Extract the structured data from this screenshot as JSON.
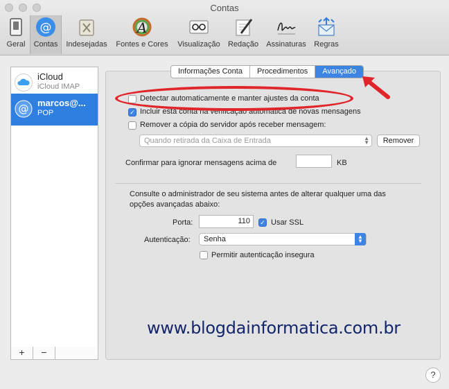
{
  "window": {
    "title": "Contas"
  },
  "toolbar": {
    "items": [
      {
        "label": "Geral",
        "icon": "switch-icon"
      },
      {
        "label": "Contas",
        "icon": "at-sign-icon",
        "selected": true
      },
      {
        "label": "Indesejadas",
        "icon": "junk-trash-icon"
      },
      {
        "label": "Fontes e Cores",
        "icon": "fonts-colors-icon"
      },
      {
        "label": "Visualização",
        "icon": "glasses-icon"
      },
      {
        "label": "Redação",
        "icon": "pencil-paper-icon"
      },
      {
        "label": "Assinaturas",
        "icon": "signature-icon"
      },
      {
        "label": "Regras",
        "icon": "rules-envelope-icon"
      }
    ]
  },
  "sidebar": {
    "accounts": [
      {
        "name": "iCloud",
        "type": "iCloud IMAP",
        "icon": "icloud-icon"
      },
      {
        "name": "marcos@...",
        "type": "POP",
        "icon": "at-sign-icon",
        "selected": true
      }
    ],
    "add_label": "+",
    "remove_label": "−"
  },
  "tabs": [
    {
      "label": "Informações Conta"
    },
    {
      "label": "Procedimentos"
    },
    {
      "label": "Avançado",
      "selected": true
    }
  ],
  "advanced": {
    "auto_detect": {
      "label": "Detectar automaticamente e manter ajustes da conta",
      "checked": false
    },
    "include_check": {
      "label": "Incluir esta conta na verificação automática de novas mensagens",
      "checked": true
    },
    "remove_copy": {
      "label": "Remover a cópia do servidor após receber mensagem:",
      "checked": false
    },
    "remove_when": {
      "value": "Quando retirada da Caixa de Entrada"
    },
    "remove_button": "Remover",
    "ignore_label": "Confirmar para ignorar mensagens acima de",
    "ignore_value": "",
    "ignore_unit": "KB",
    "admin_note_1": "Consulte o administrador de seu sistema antes de alterar qualquer uma das",
    "admin_note_2": "opções avançadas abaixo:",
    "port_label": "Porta:",
    "port_value": "110",
    "ssl": {
      "label": "Usar SSL",
      "checked": true
    },
    "auth_label": "Autenticação:",
    "auth_value": "Senha",
    "insecure_auth": {
      "label": "Permitir autenticação insegura",
      "checked": false
    }
  },
  "watermark": "www.blogdainformatica.com.br",
  "help_label": "?",
  "colors": {
    "accent": "#3d84e3",
    "annotation": "#e0262b",
    "watermark": "#14266b"
  }
}
